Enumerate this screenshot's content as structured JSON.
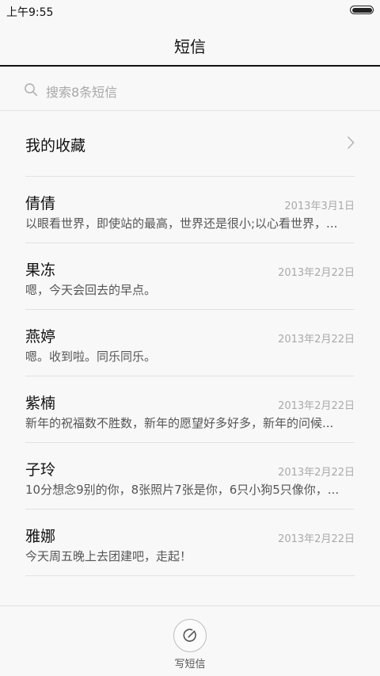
{
  "status_bar": {
    "time": "上午9:55",
    "battery_icon": "battery-icon"
  },
  "header": {
    "title": "短信"
  },
  "search": {
    "icon": "search-icon",
    "placeholder": "搜索8条短信"
  },
  "favorites": {
    "label": "我的收藏",
    "icon": "chevron-right-icon"
  },
  "messages": [
    {
      "name": "倩倩",
      "date": "2013年3月1日",
      "preview": "以眼看世界，即使站的最高，世界还是很小;以心看世界，..."
    },
    {
      "name": "果冻",
      "date": "2013年2月22日",
      "preview": "嗯，今天会回去的早点。"
    },
    {
      "name": "燕婷",
      "date": "2013年2月22日",
      "preview": "嗯。收到啦。同乐同乐。"
    },
    {
      "name": "紫楠",
      "date": "2013年2月22日",
      "preview": "新年的祝福数不胜数，新年的愿望好多好多，新年的问候..."
    },
    {
      "name": "子玲",
      "date": "2013年2月22日",
      "preview": "10分想念9别的你，8张照片7张是你，6只小狗5只像你，..."
    },
    {
      "name": "雅娜",
      "date": "2013年2月22日",
      "preview": "今天周五晚上去团建吧，走起！"
    }
  ],
  "compose": {
    "icon": "compose-icon",
    "label": "写短信"
  }
}
